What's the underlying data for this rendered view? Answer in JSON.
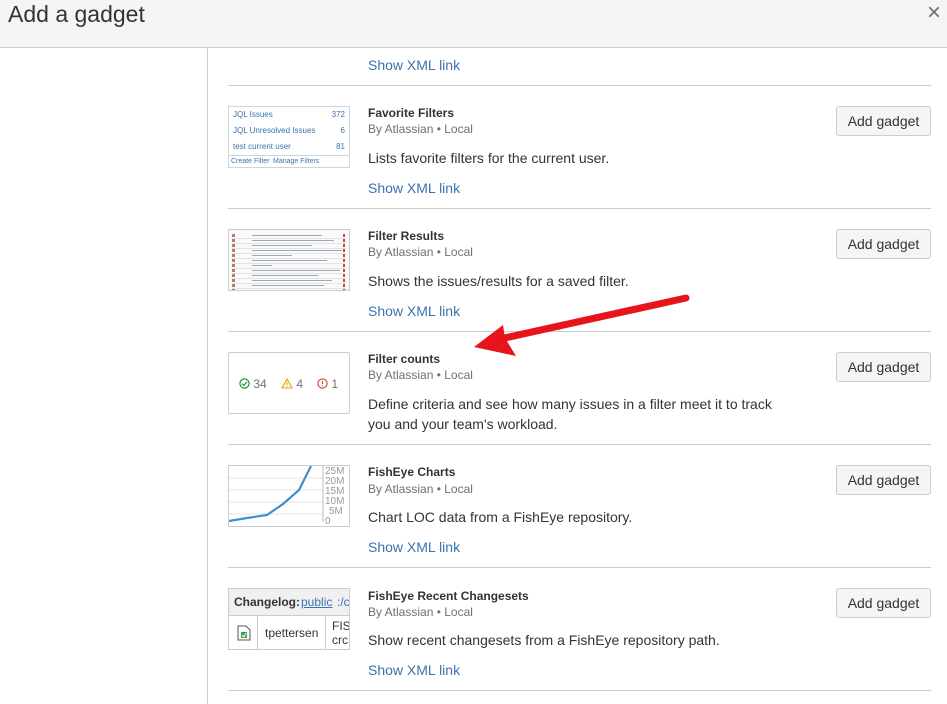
{
  "dialog": {
    "title": "Add a gadget",
    "close_glyph": "×"
  },
  "top_partial": {
    "xml_link": "Show XML link"
  },
  "gadgets": [
    {
      "name": "Favorite Filters",
      "by": "By Atlassian • Local",
      "description": "Lists favorite filters for the current user.",
      "xml_link": "Show XML link",
      "add_label": "Add gadget",
      "thumb": {
        "rows": [
          {
            "label": "JQL Issues",
            "count": "372"
          },
          {
            "label": "JQL Unresolved Issues",
            "count": "6"
          },
          {
            "label": "test current user",
            "count": "81"
          }
        ],
        "footer_left": "Create Filter",
        "footer_right": "Manage Filters"
      }
    },
    {
      "name": "Filter Results",
      "by": "By Atlassian • Local",
      "description": "Shows the issues/results for a saved filter.",
      "xml_link": "Show XML link",
      "add_label": "Add gadget"
    },
    {
      "name": "Filter counts",
      "by": "By Atlassian • Local",
      "description_line1": "Define criteria and see how many issues in a filter meet it to track",
      "description_line2": "you and your team's workload.",
      "add_label": "Add gadget",
      "thumb": {
        "ok_count": "34",
        "warn_count": "4",
        "error_count": "1"
      }
    },
    {
      "name": "FishEye Charts",
      "by": "By Atlassian • Local",
      "description": "Chart LOC data from a FishEye repository.",
      "xml_link": "Show XML link",
      "add_label": "Add gadget",
      "thumb": {
        "axis_labels": [
          "25M",
          "20M",
          "15M",
          "10M",
          "5M",
          "0"
        ],
        "line_color": "#3d8fcd"
      }
    },
    {
      "name": "FishEye Recent Changesets",
      "by": "By Atlassian • Local",
      "description": "Show recent changesets from a FishEye repository path.",
      "xml_link": "Show XML link",
      "add_label": "Add gadget",
      "thumb": {
        "header_label": "Changelog:",
        "header_link": "public",
        "header_rest": ":/cc",
        "user": "tpettersen",
        "col_top": "FIS",
        "col_bottom": "crc"
      }
    }
  ],
  "annotation": {
    "type": "arrow",
    "color": "#e8141b",
    "points_to": "Filter counts"
  },
  "colors": {
    "link": "#3b73af",
    "header_bg": "#f5f5f5",
    "border": "#cccccc"
  }
}
